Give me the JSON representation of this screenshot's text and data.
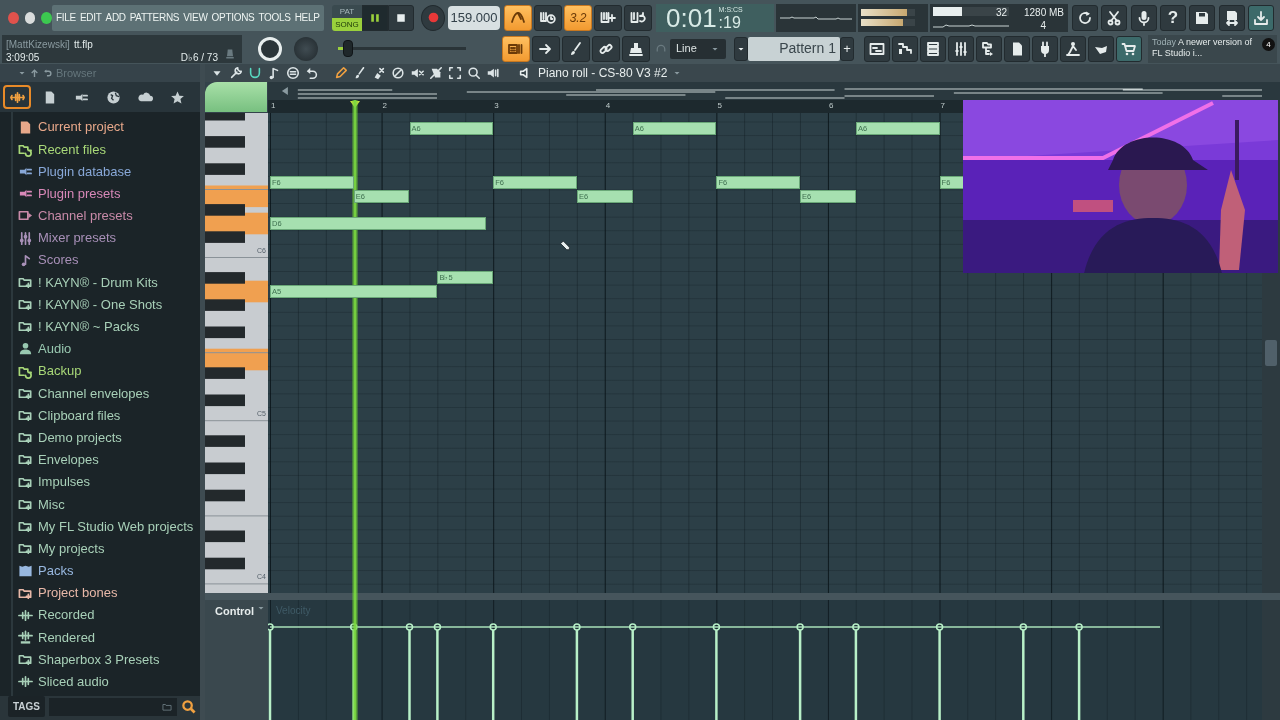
{
  "window_controls": [
    {
      "color": "#e0524c"
    },
    {
      "color": "#d9dcdc"
    },
    {
      "color": "#3cc850"
    }
  ],
  "menu": [
    "FILE",
    "EDIT",
    "ADD",
    "PATTERNS",
    "VIEW",
    "OPTIONS",
    "TOOLS",
    "HELP"
  ],
  "hint": {
    "user": "[MattKizewski]",
    "file": "tt.flp",
    "time": "3:09:05",
    "note": "D♭6 / 73"
  },
  "transport": {
    "modes": [
      {
        "label": "PAT",
        "selected": false
      },
      {
        "label": "SONG",
        "selected": true
      }
    ],
    "playing": true,
    "tempo": "159.000"
  },
  "toggles_top": [
    {
      "kind": "metronome",
      "on": true
    },
    {
      "kind": "wait",
      "on": false
    },
    {
      "kind": "countdown",
      "text": "3.2",
      "on": true
    },
    {
      "kind": "step",
      "on": false
    },
    {
      "kind": "loop",
      "on": false
    }
  ],
  "toggles_bottom": [
    {
      "kind": "typing",
      "on": true
    },
    {
      "kind": "arrow",
      "on": false
    },
    {
      "kind": "brush",
      "on": false
    },
    {
      "kind": "link",
      "on": false
    },
    {
      "kind": "stamp",
      "on": false
    }
  ],
  "position_slider": {
    "level": 0.08
  },
  "clock": {
    "main": "0:01",
    "sub": ":19",
    "format": "M:S:CS"
  },
  "meters": [
    {
      "level": 0.86
    },
    {
      "level": 0.78
    }
  ],
  "cpu": {
    "level": 0.38,
    "polyphony": "32",
    "memory": "1280 MB",
    "voices": "4"
  },
  "help_label": "?",
  "snap": "Line",
  "pattern": {
    "name": "Pattern 1",
    "add": "+"
  },
  "news": {
    "label": "Today",
    "text": "A newer version of FL Studio i...",
    "count": "4"
  },
  "browser": {
    "title": "Browser",
    "tabs": [
      {
        "kind": "all",
        "selected": true
      },
      {
        "kind": "files",
        "selected": false
      },
      {
        "kind": "plugins",
        "selected": false
      },
      {
        "kind": "web",
        "selected": false
      },
      {
        "kind": "cloud",
        "selected": false
      },
      {
        "kind": "starred",
        "selected": false
      }
    ],
    "items": [
      {
        "label": "Current project",
        "kind": "project",
        "color": "#e8a88a"
      },
      {
        "label": "Recent files",
        "kind": "recent",
        "color": "#a8d878"
      },
      {
        "label": "Plugin database",
        "kind": "plugin",
        "color": "#88a8d8"
      },
      {
        "label": "Plugin presets",
        "kind": "plugin",
        "color": "#d888b8"
      },
      {
        "label": "Channel presets",
        "kind": "channel",
        "color": "#c88aa8"
      },
      {
        "label": "Mixer presets",
        "kind": "mixer",
        "color": "#a890b8"
      },
      {
        "label": "Scores",
        "kind": "score",
        "color": "#a890b8"
      },
      {
        "label": "! KAYN® - Drum Kits",
        "kind": "folder",
        "color": "#a8d0b8"
      },
      {
        "label": "! KAYN® - One Shots",
        "kind": "folder",
        "color": "#a8d0b8"
      },
      {
        "label": "! KAYN® ~ Packs",
        "kind": "folder",
        "color": "#a8d0b8"
      },
      {
        "label": "Audio",
        "kind": "audio",
        "color": "#98c8b0"
      },
      {
        "label": "Backup",
        "kind": "recent",
        "color": "#a8d878"
      },
      {
        "label": "Channel envelopes",
        "kind": "folder",
        "color": "#a8d0b8"
      },
      {
        "label": "Clipboard files",
        "kind": "folder",
        "color": "#a8d0b8"
      },
      {
        "label": "Demo projects",
        "kind": "folder",
        "color": "#a8d0b8"
      },
      {
        "label": "Envelopes",
        "kind": "folder",
        "color": "#a8d0b8"
      },
      {
        "label": "Impulses",
        "kind": "folder",
        "color": "#a8d0b8"
      },
      {
        "label": "Misc",
        "kind": "folder",
        "color": "#a8d0b8"
      },
      {
        "label": "My FL Studio Web projects",
        "kind": "folder",
        "color": "#a8d0b8"
      },
      {
        "label": "My projects",
        "kind": "folder",
        "color": "#a8d0b8"
      },
      {
        "label": "Packs",
        "kind": "packs",
        "color": "#98b8e0"
      },
      {
        "label": "Project bones",
        "kind": "folder",
        "color": "#e8b8a8"
      },
      {
        "label": "Recorded",
        "kind": "wave",
        "color": "#a8d0b8"
      },
      {
        "label": "Rendered",
        "kind": "render",
        "color": "#a8d0b8"
      },
      {
        "label": "Shaperbox 3 Presets",
        "kind": "folder",
        "color": "#a8d0b8"
      },
      {
        "label": "Sliced audio",
        "kind": "wave",
        "color": "#a8d0b8"
      }
    ],
    "tags": "TAGS"
  },
  "piano_roll": {
    "title": "Piano roll - CS-80 V3 #2",
    "tools": [
      {
        "kind": "menu",
        "on": false
      },
      {
        "kind": "wrench",
        "on": false
      },
      {
        "kind": "magnet",
        "on": true
      },
      {
        "kind": "note",
        "on": false
      },
      {
        "kind": "options",
        "on": false
      },
      {
        "kind": "undo",
        "on": false
      },
      {
        "kind": "pencil",
        "on": true
      },
      {
        "kind": "brush",
        "on": false
      },
      {
        "kind": "erase",
        "on": false
      },
      {
        "kind": "forbid",
        "on": false
      },
      {
        "kind": "mute",
        "on": false
      },
      {
        "kind": "slice",
        "on": false
      },
      {
        "kind": "select",
        "on": false
      },
      {
        "kind": "zoom",
        "on": false
      },
      {
        "kind": "playback",
        "on": false
      }
    ],
    "bars": [
      "1",
      "2",
      "3",
      "4",
      "5",
      "6",
      "7"
    ],
    "key_labels": [
      "C6",
      "C5",
      "C4"
    ],
    "notes": [
      {
        "label": "F6"
      },
      {
        "label": "D6"
      },
      {
        "label": "A5"
      },
      {
        "label": "E6"
      },
      {
        "label": "A6"
      },
      {
        "label": "B♭5"
      },
      {
        "label": "F6"
      },
      {
        "label": "E6"
      },
      {
        "label": "A6"
      },
      {
        "label": "F6"
      },
      {
        "label": "E6"
      },
      {
        "label": "A6"
      },
      {
        "label": "F6"
      }
    ],
    "control": "Control",
    "event": "Velocity"
  }
}
